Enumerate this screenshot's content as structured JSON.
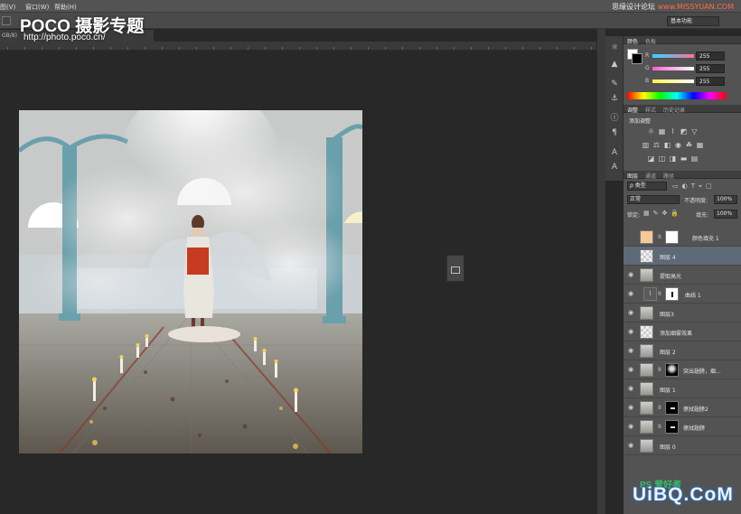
{
  "menubar": {
    "items": [
      "图(V)",
      "窗口(W)",
      "帮助(H)"
    ],
    "site_caption_a": "思缘设计论坛 ",
    "site_caption_b": "www.MISSYUAN.COM"
  },
  "optbar": {
    "workspace": "基本功能"
  },
  "watermark": {
    "logo": "POCO 摄影专题",
    "url": "http://photo.poco.cn/"
  },
  "doc_tab": "GB/8)",
  "color_panel": {
    "tabs": [
      "颜色",
      "色板"
    ],
    "channels": [
      {
        "label": "R",
        "value": "255",
        "color": "#ff4f7a"
      },
      {
        "label": "G",
        "value": "255",
        "color": "#3fe0ff"
      },
      {
        "label": "B",
        "value": "255",
        "color": "#ffe34a"
      }
    ]
  },
  "adjust_panel": {
    "tabs": [
      "调整",
      "样式",
      "历史记录"
    ],
    "title": "添加调整"
  },
  "layers_panel": {
    "tabs": [
      "图层",
      "通道",
      "路径"
    ],
    "kind_filter": "类型",
    "blend_mode": "正常",
    "opacity_label": "不透明度:",
    "opacity_value": "100%",
    "lock_label": "锁定:",
    "fill_label": "填充:",
    "fill_value": "100%",
    "layers": [
      {
        "name": "颜色填充 1",
        "visible": false,
        "thumb": "fill",
        "mask": "white"
      },
      {
        "name": "图层 4",
        "visible": false,
        "thumb": "transp",
        "selected": true
      },
      {
        "name": "提取高光",
        "visible": true,
        "thumb": "photo"
      },
      {
        "name": "曲线 1",
        "visible": true,
        "thumb": "adj",
        "mask": "curve"
      },
      {
        "name": "图层3",
        "visible": true,
        "thumb": "photo"
      },
      {
        "name": "添加烟雾效果",
        "visible": true,
        "thumb": "transp"
      },
      {
        "name": "图层 2",
        "visible": true,
        "thumb": "photo"
      },
      {
        "name": "突出翅膀，烟...",
        "visible": true,
        "thumb": "photo",
        "mask": "dark-smoke"
      },
      {
        "name": "图层 1",
        "visible": true,
        "thumb": "photo"
      },
      {
        "name": "擦拭翅膀2",
        "visible": true,
        "thumb": "photo",
        "mask": "dark"
      },
      {
        "name": "擦拭翅膀",
        "visible": true,
        "thumb": "photo",
        "mask": "dark"
      },
      {
        "name": "图层 0",
        "visible": true,
        "thumb": "photo"
      }
    ]
  },
  "site_logo": {
    "ps": "PS 爱好者",
    "uibq": "UiBQ.CoM"
  }
}
